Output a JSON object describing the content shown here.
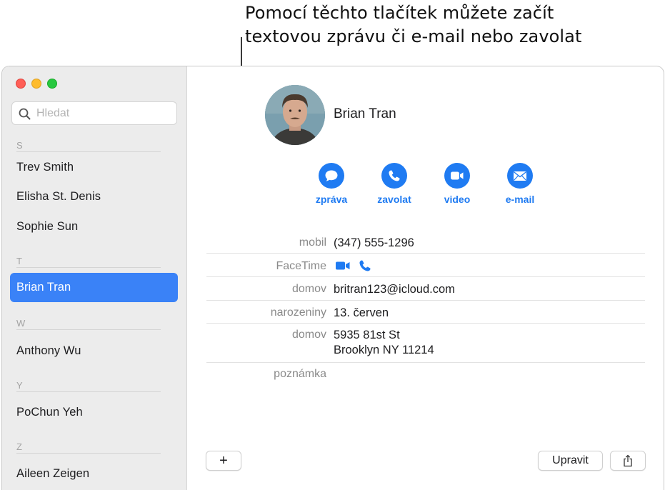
{
  "callout": {
    "line1": "Pomocí těchto tlačítek můžete začít",
    "line2": "textovou zprávu či e-mail nebo zavolat"
  },
  "window": {
    "controls": [
      "close",
      "minimize",
      "zoom"
    ]
  },
  "sidebar": {
    "search": {
      "placeholder": "Hledat",
      "value": ""
    },
    "sections": [
      {
        "letter": "S",
        "contacts": [
          "Trev Smith",
          "Elisha St. Denis",
          "Sophie Sun"
        ]
      },
      {
        "letter": "T",
        "contacts": [
          "Brian Tran"
        ]
      },
      {
        "letter": "W",
        "contacts": [
          "Anthony Wu"
        ]
      },
      {
        "letter": "Y",
        "contacts": [
          "PoChun Yeh"
        ]
      },
      {
        "letter": "Z",
        "contacts": [
          "Aileen Zeigen"
        ]
      }
    ],
    "selected": "Brian Tran"
  },
  "detail": {
    "name": "Brian Tran",
    "actions": [
      {
        "label": "zpráva",
        "icon": "message-bubble-icon"
      },
      {
        "label": "zavolat",
        "icon": "phone-icon"
      },
      {
        "label": "video",
        "icon": "video-camera-icon"
      },
      {
        "label": "e-mail",
        "icon": "envelope-icon"
      }
    ],
    "fields": {
      "mobile_label": "mobil",
      "mobile_value": "(347) 555-1296",
      "facetime_label": "FaceTime",
      "email_label": "domov",
      "email_value": "britran123@icloud.com",
      "birthday_label": "narozeniny",
      "birthday_value": "13. červen",
      "address_label": "domov",
      "address_line1": "5935 81st St",
      "address_line2": "Brooklyn NY 11214",
      "note_label": "poznámka"
    }
  },
  "footer": {
    "add_label": "+",
    "edit_label": "Upravit",
    "share_icon": "share-icon"
  },
  "colors": {
    "accent": "#1f7bf2",
    "selection": "#3a82f7",
    "sidebar_bg": "#ececec"
  }
}
